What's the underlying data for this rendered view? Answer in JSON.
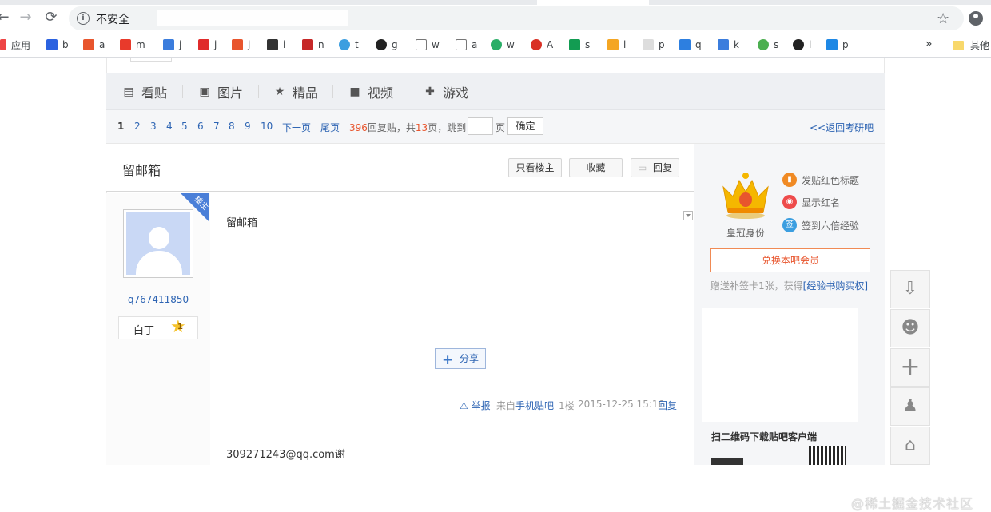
{
  "browser": {
    "security_label": "不安全",
    "info_icon": "i",
    "back_icon": "←",
    "forward_icon": "→",
    "reload_icon": "⟳",
    "star_icon": "☆"
  },
  "bookmarks": {
    "items": [
      {
        "label": "应用",
        "icon": "apps-icon",
        "color": "#e34"
      },
      {
        "label": "b",
        "icon": "baidu-icon",
        "color": "#2b62e0"
      },
      {
        "label": "a",
        "icon": "a-icon",
        "color": "#e8552d"
      },
      {
        "label": "m",
        "icon": "flame-icon",
        "color": "#e83a2b"
      },
      {
        "label": "j",
        "icon": "j-icon",
        "color": "#3b7ddd"
      },
      {
        "label": "j",
        "icon": "c-icon",
        "color": "#e02b2b"
      },
      {
        "label": "j",
        "icon": "jianshu-icon",
        "color": "#e8552d"
      },
      {
        "label": "i",
        "icon": "camera-icon",
        "color": "#333"
      },
      {
        "label": "n",
        "icon": "n-icon",
        "color": "#c62828"
      },
      {
        "label": "t",
        "icon": "cloud-icon",
        "color": "#3b9ee0"
      },
      {
        "label": "g",
        "icon": "github-icon",
        "color": "#222"
      },
      {
        "label": "w",
        "icon": "doc-icon",
        "color": "#777"
      },
      {
        "label": "a",
        "icon": "doc-icon",
        "color": "#777"
      },
      {
        "label": "w",
        "icon": "wechat-icon",
        "color": "#2aae67"
      },
      {
        "label": "A",
        "icon": "a2-icon",
        "color": "#d93025"
      },
      {
        "label": "s",
        "icon": "sf-icon",
        "color": "#129c52"
      },
      {
        "label": "l",
        "icon": "l-icon",
        "color": "#f4a623"
      },
      {
        "label": "p",
        "icon": "p-icon",
        "color": "#ccc"
      },
      {
        "label": "q",
        "icon": "q-icon",
        "color": "#2d7fe0"
      },
      {
        "label": "k",
        "icon": "k-icon",
        "color": "#3b7ddd"
      },
      {
        "label": "s",
        "icon": "s-icon",
        "color": "#4caf50"
      },
      {
        "label": "l",
        "icon": "penguin-icon",
        "color": "#222"
      },
      {
        "label": "p",
        "icon": "on-icon",
        "color": "#1e88e5"
      }
    ],
    "more": "»",
    "other": "其他"
  },
  "tieba": {
    "nav": [
      {
        "label": "看贴",
        "icon": "doc-icon"
      },
      {
        "label": "图片",
        "icon": "image-icon"
      },
      {
        "label": "精品",
        "icon": "star-icon"
      },
      {
        "label": "视频",
        "icon": "video-icon"
      },
      {
        "label": "游戏",
        "icon": "gamepad-icon"
      }
    ],
    "pager": {
      "pages": [
        "1",
        "2",
        "3",
        "4",
        "5",
        "6",
        "7",
        "8",
        "9",
        "10"
      ],
      "next": "下一页",
      "last": "尾页",
      "reply_count": "396",
      "reply_text": "回复贴，共",
      "total_pages": "13",
      "jump_text": "页，跳到",
      "page_unit": "页",
      "confirm": "确定",
      "back_link": "<<返回考研吧"
    },
    "thread": {
      "title": "留邮箱",
      "btn_only_op": "只看楼主",
      "btn_fav": "收藏",
      "btn_reply": "回复"
    },
    "post1": {
      "badge": "楼主",
      "username": "q767411850",
      "level_name": "白丁",
      "level_num": "1",
      "content": "留邮箱",
      "share": "分享",
      "report": "⚠ 举报",
      "source": "来自",
      "source_link": "手机贴吧",
      "floor": "1楼",
      "time": "2015-12-25 15:16",
      "reply": "回复"
    },
    "post2": {
      "content": "309271243@qq.com谢"
    },
    "sidebar": {
      "crown_label": "皇冠身份",
      "perks": [
        {
          "label": "发贴红色标题",
          "color": "#f08a24"
        },
        {
          "label": "显示红名",
          "color": "#ee4b4b"
        },
        {
          "label": "签到六倍经验",
          "color": "#3b9ee0"
        }
      ],
      "member_btn": "兑换本吧会员",
      "sign_tip": "赠送补签卡1张，获得",
      "sign_link": "[经验书购买权]",
      "qr_title": "扫二维码下载贴吧客户端"
    },
    "float": {
      "items": [
        "download-icon",
        "bear-icon",
        "plus-icon",
        "user-icon",
        "lock-icon"
      ]
    }
  },
  "watermark": "@稀土掘金技术社区"
}
